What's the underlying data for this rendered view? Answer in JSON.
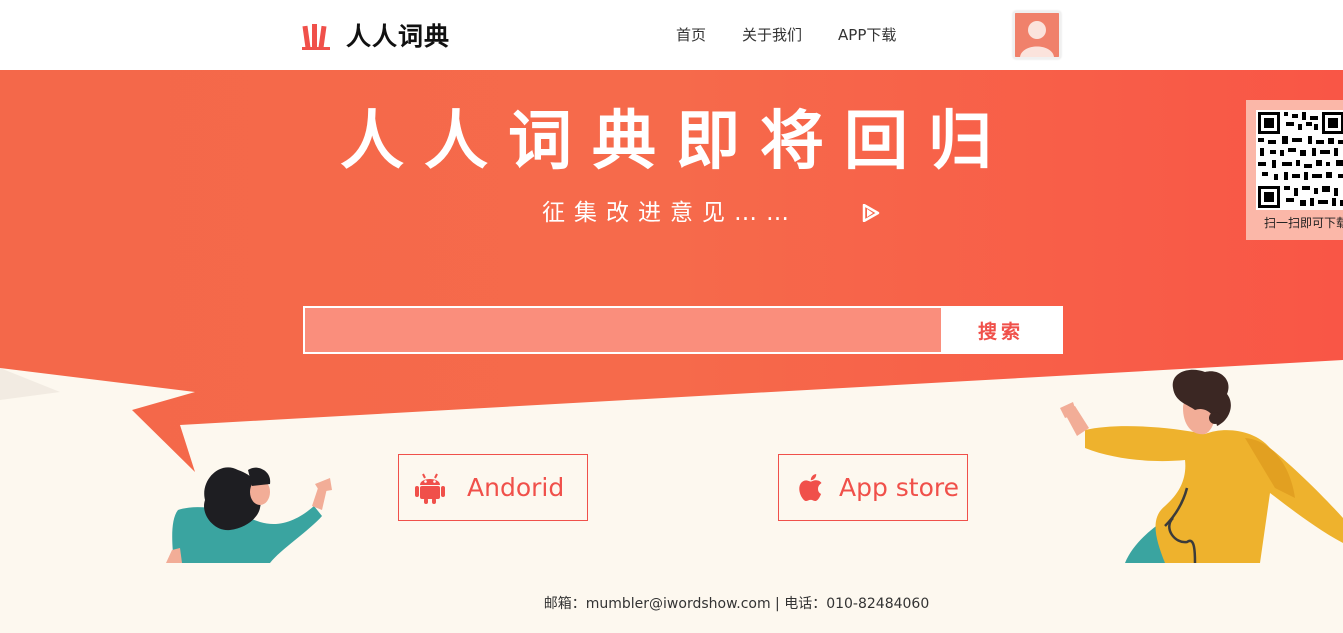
{
  "header": {
    "logo_text": "人人词典",
    "nav": [
      {
        "label": "首页"
      },
      {
        "label": "关于我们"
      },
      {
        "label": "APP下载"
      }
    ]
  },
  "hero": {
    "title": "人人词典即将回归",
    "subtitle": "征集改进意见……",
    "search": {
      "value": "",
      "placeholder": "",
      "button_label": "搜索"
    },
    "downloads": [
      {
        "label": "Andorid",
        "icon": "android-icon"
      },
      {
        "label": "App store",
        "icon": "apple-icon"
      }
    ]
  },
  "qr": {
    "caption": "扫一扫即可下载"
  },
  "footer": {
    "text": "邮箱：mumbler@iwordshow.com | 电话：010-82484060"
  },
  "colors": {
    "primary": "#f0504a",
    "hero_orange": "#f76a4a",
    "cream": "#fdf8ef",
    "search_field": "#fa8e7c"
  }
}
